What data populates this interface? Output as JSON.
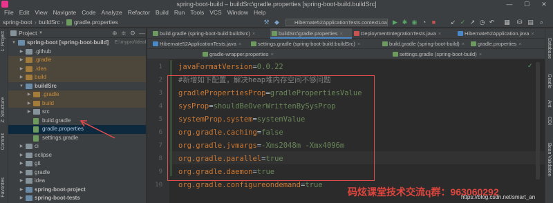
{
  "window": {
    "title": "spring-boot-build – buildSrc\\gradle.properties [spring-boot-build.buildSrc]",
    "minimize": "—",
    "maximize": "☐",
    "close": "✕"
  },
  "menu": [
    "File",
    "Edit",
    "View",
    "Navigate",
    "Code",
    "Analyze",
    "Refactor",
    "Build",
    "Run",
    "Tools",
    "VCS",
    "Window",
    "Help"
  ],
  "nav": {
    "crumbs": [
      "spring-boot",
      "buildSrc",
      "gradle.properties"
    ],
    "run_config": "Hibernate52ApplicationTests.contextLoads"
  },
  "left_strip": {
    "project": "1: Project",
    "structure": "Z: Structure",
    "commit": "Commit",
    "favorites": "Favorites"
  },
  "right_strip": {
    "database": "Database",
    "gradle": "Gradle",
    "ant": "Ant",
    "cdi": "CDI",
    "bean_validation": "Bean Validation"
  },
  "project_panel": {
    "title": "Project",
    "tree": [
      {
        "label": "spring-boot [spring-boot-build]",
        "suffix": "E:\\mypro\\IdeaPr",
        "depth": 0,
        "arrow": "▼",
        "kind": "mod",
        "style": "bold"
      },
      {
        "label": ".github",
        "depth": 1,
        "arrow": "▶",
        "kind": "plain",
        "style": ""
      },
      {
        "label": ".gradle",
        "depth": 1,
        "arrow": "▶",
        "kind": "ign",
        "style": "ignored"
      },
      {
        "label": ".idea",
        "depth": 1,
        "arrow": "▶",
        "kind": "ign",
        "style": "ignored"
      },
      {
        "label": "build",
        "depth": 1,
        "arrow": "▶",
        "kind": "ign",
        "style": "ignored"
      },
      {
        "label": "buildSrc",
        "depth": 1,
        "arrow": "▼",
        "kind": "mod",
        "style": "bold"
      },
      {
        "label": ".gradle",
        "depth": 2,
        "arrow": "▶",
        "kind": "ign",
        "style": "ignored"
      },
      {
        "label": "build",
        "depth": 2,
        "arrow": "▶",
        "kind": "ign",
        "style": "ignored"
      },
      {
        "label": "src",
        "depth": 2,
        "arrow": "▶",
        "kind": "plain",
        "style": ""
      },
      {
        "label": "build.gradle",
        "depth": 2,
        "arrow": "",
        "kind": "file",
        "style": ""
      },
      {
        "label": "gradle.properties",
        "depth": 2,
        "arrow": "",
        "kind": "file",
        "style": "selected"
      },
      {
        "label": "settings.gradle",
        "depth": 2,
        "arrow": "",
        "kind": "file",
        "style": ""
      },
      {
        "label": "ci",
        "depth": 1,
        "arrow": "▶",
        "kind": "plain",
        "style": ""
      },
      {
        "label": "eclipse",
        "depth": 1,
        "arrow": "▶",
        "kind": "plain",
        "style": ""
      },
      {
        "label": "git",
        "depth": 1,
        "arrow": "▶",
        "kind": "plain",
        "style": ""
      },
      {
        "label": "gradle",
        "depth": 1,
        "arrow": "▶",
        "kind": "plain",
        "style": ""
      },
      {
        "label": "idea",
        "depth": 1,
        "arrow": "▶",
        "kind": "plain",
        "style": ""
      },
      {
        "label": "spring-boot-project",
        "depth": 1,
        "arrow": "▶",
        "kind": "mod",
        "style": "bold"
      },
      {
        "label": "spring-boot-tests",
        "depth": 1,
        "arrow": "▶",
        "kind": "mod",
        "style": "bold"
      },
      {
        "label": "src",
        "depth": 1,
        "arrow": "▶",
        "kind": "plain",
        "style": ""
      }
    ]
  },
  "tabs": {
    "row1": [
      {
        "label": "build.gradle (spring-boot-build:buildSrc)",
        "color": "#6d9a5f",
        "active": false
      },
      {
        "label": "buildSrc\\gradle.properties",
        "color": "#6d9a5f",
        "active": true
      },
      {
        "label": "DeploymentIntegrationTests.java",
        "color": "#c75450",
        "active": false
      },
      {
        "label": "Hibernate52Application.java",
        "color": "#4a88c7",
        "active": false
      }
    ],
    "row2": [
      {
        "label": "Hibernate52ApplicationTests.java",
        "color": "#4a88c7",
        "active": false
      },
      {
        "label": "settings.gradle (spring-boot-build:buildSrc)",
        "color": "#6d9a5f",
        "active": false
      },
      {
        "label": "build.gradle (spring-boot-build)",
        "color": "#6d9a5f",
        "active": false
      },
      {
        "label": "gradle.properties",
        "color": "#6d9a5f",
        "active": false
      }
    ],
    "row3": [
      {
        "label": "gradle-wrapper.properties",
        "color": "#6d9a5f",
        "active": false
      },
      {
        "label": "settings.gradle (spring-boot-build)",
        "color": "#6d9a5f",
        "active": false
      }
    ]
  },
  "editor": {
    "lines": [
      {
        "n": "1",
        "key": "javaFormatVersion",
        "val": "0.0.22",
        "comment": ""
      },
      {
        "n": "2",
        "key": "",
        "val": "",
        "comment": "#新增如下配置，解决heap堆内存空间不够问题"
      },
      {
        "n": "3",
        "key": "gradlePropertiesProp",
        "val": "gradlePropertiesValue",
        "comment": ""
      },
      {
        "n": "4",
        "key": "sysProp",
        "val": "shouldBeOverWrittenBySysProp",
        "comment": ""
      },
      {
        "n": "5",
        "key": "systemProp.system",
        "val": "systemValue",
        "comment": ""
      },
      {
        "n": "6",
        "key": "org.gradle.caching",
        "val": "false",
        "comment": ""
      },
      {
        "n": "7",
        "key": "org.gradle.jvmargs",
        "val": "-Xms2048m -Xmx4096m",
        "comment": ""
      },
      {
        "n": "8",
        "key": "org.gradle.parallel",
        "val": "true",
        "comment": ""
      },
      {
        "n": "9",
        "key": "org.gradle.daemon",
        "val": "true",
        "comment": ""
      },
      {
        "n": "10",
        "key": "org.gradle.configureondemand",
        "val": "true",
        "comment": ""
      }
    ],
    "equals": "="
  },
  "watermark": {
    "text": "码炫课堂技术交流q群：963060292",
    "url": "https://blog.csdn.net/smart_an"
  }
}
